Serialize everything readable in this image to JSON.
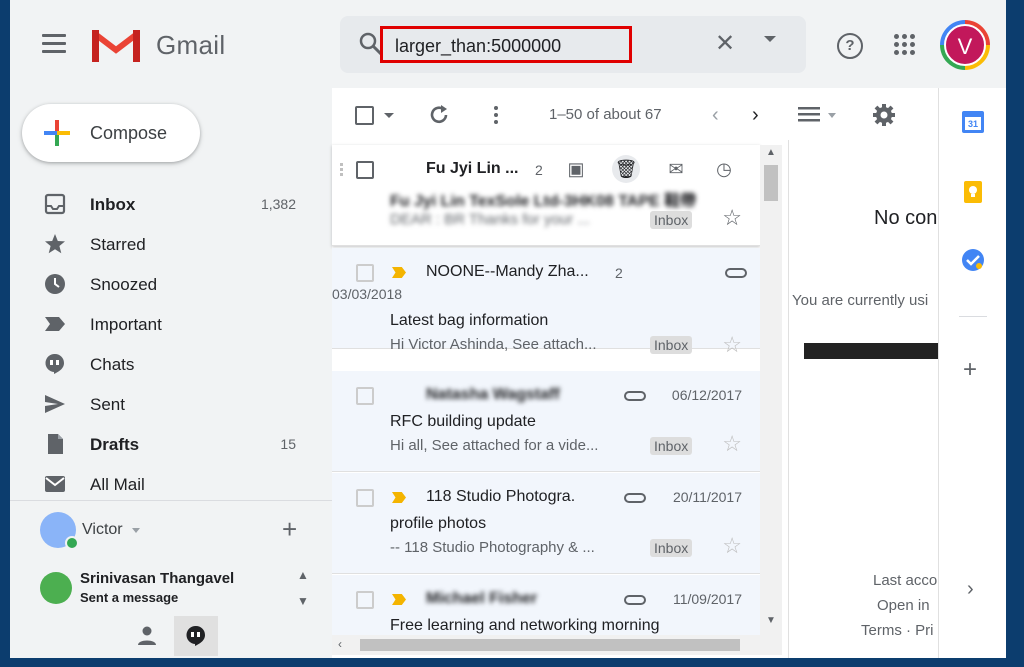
{
  "header": {
    "logo_text": "Gmail",
    "search_value": "larger_than:5000000",
    "avatar_letter": "V"
  },
  "sidebar": {
    "compose_label": "Compose",
    "items": [
      {
        "label": "Inbox",
        "count": "1,382",
        "icon": "inbox-icon",
        "bold": true
      },
      {
        "label": "Starred",
        "count": "",
        "icon": "star-icon",
        "bold": false
      },
      {
        "label": "Snoozed",
        "count": "",
        "icon": "clock-icon",
        "bold": false
      },
      {
        "label": "Important",
        "count": "",
        "icon": "important-icon",
        "bold": false
      },
      {
        "label": "Chats",
        "count": "",
        "icon": "chat-icon",
        "bold": false
      },
      {
        "label": "Sent",
        "count": "",
        "icon": "send-icon",
        "bold": false
      },
      {
        "label": "Drafts",
        "count": "15",
        "icon": "draft-icon",
        "bold": true
      },
      {
        "label": "All Mail",
        "count": "",
        "icon": "mail-icon",
        "bold": false
      }
    ],
    "hangouts_user": "Victor",
    "chat_name": "Srinivasan Thangavel",
    "chat_status": "Sent a message"
  },
  "toolbar": {
    "pager": "1–50 of about 67"
  },
  "emails": [
    {
      "sender": "Fu Jyi Lin ...",
      "thread": "2",
      "date": "",
      "subject": "Fu Jyi Lin TexSole Ltd-3HK08 TAPE 鞋帶",
      "snippet": "DEAR : BR Thanks for your ...",
      "label": "Inbox"
    },
    {
      "sender": "NOONE--Mandy Zha...",
      "thread": "2",
      "date": "03/03/2018",
      "subject": "Latest bag information",
      "snippet": "Hi Victor Ashinda, See attach...",
      "label": "Inbox"
    },
    {
      "sender": "Natasha Wagstaff",
      "thread": "",
      "date": "06/12/2017",
      "subject": "RFC building update",
      "snippet": "Hi all, See attached for a vide...",
      "label": "Inbox"
    },
    {
      "sender": "118 Studio Photogra.",
      "thread": "",
      "date": "20/11/2017",
      "subject": "profile photos",
      "snippet": "-- 118 Studio Photography & ...",
      "label": "Inbox"
    },
    {
      "sender": "Michael Fisher",
      "thread": "",
      "date": "11/09/2017",
      "subject": "Free learning and networking morning",
      "snippet": "",
      "label": ""
    }
  ],
  "reading_pane": {
    "title": "No con",
    "subtitle": "You are currently usi",
    "footer_1": "Last acco",
    "footer_2": "Open in",
    "footer_3": "Terms · Pri"
  },
  "colors": {
    "accent_red": "#e00000",
    "important_yellow": "#f4b400",
    "avatar_bg": "#c2185b"
  }
}
